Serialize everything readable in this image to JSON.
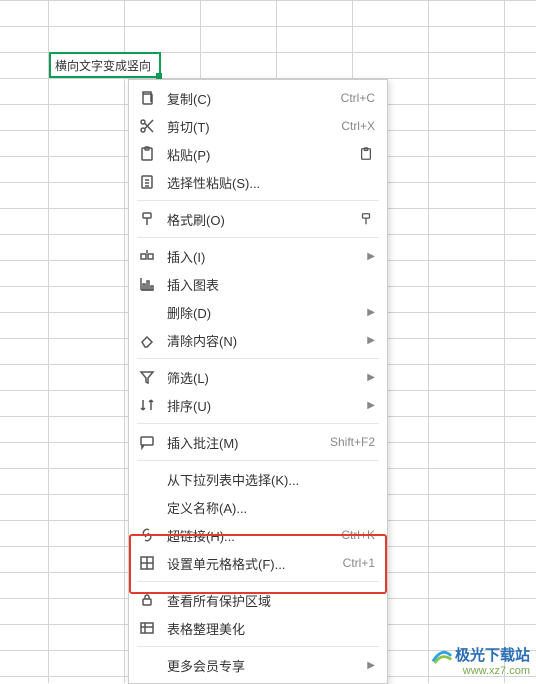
{
  "cell": {
    "text": "横向文字变成竖向"
  },
  "menu": {
    "copy": {
      "label": "复制(C)",
      "shortcut": "Ctrl+C"
    },
    "cut": {
      "label": "剪切(T)",
      "shortcut": "Ctrl+X"
    },
    "paste": {
      "label": "粘贴(P)"
    },
    "paste_special": {
      "label": "选择性粘贴(S)..."
    },
    "format_painter": {
      "label": "格式刷(O)"
    },
    "insert": {
      "label": "插入(I)"
    },
    "insert_chart": {
      "label": "插入图表"
    },
    "delete": {
      "label": "删除(D)"
    },
    "clear": {
      "label": "清除内容(N)"
    },
    "filter": {
      "label": "筛选(L)"
    },
    "sort": {
      "label": "排序(U)"
    },
    "insert_comment": {
      "label": "插入批注(M)",
      "shortcut": "Shift+F2"
    },
    "dropdown_select": {
      "label": "从下拉列表中选择(K)..."
    },
    "define_name": {
      "label": "定义名称(A)..."
    },
    "hyperlink": {
      "label": "超链接(H)...",
      "shortcut": "Ctrl+K"
    },
    "format_cells": {
      "label": "设置单元格格式(F)...",
      "shortcut": "Ctrl+1"
    },
    "view_protection": {
      "label": "查看所有保护区域"
    },
    "table_beautify": {
      "label": "表格整理美化"
    },
    "more_member": {
      "label": "更多会员专享"
    }
  },
  "watermark": {
    "title": "极光下载站",
    "url": "www.xz7.com"
  }
}
